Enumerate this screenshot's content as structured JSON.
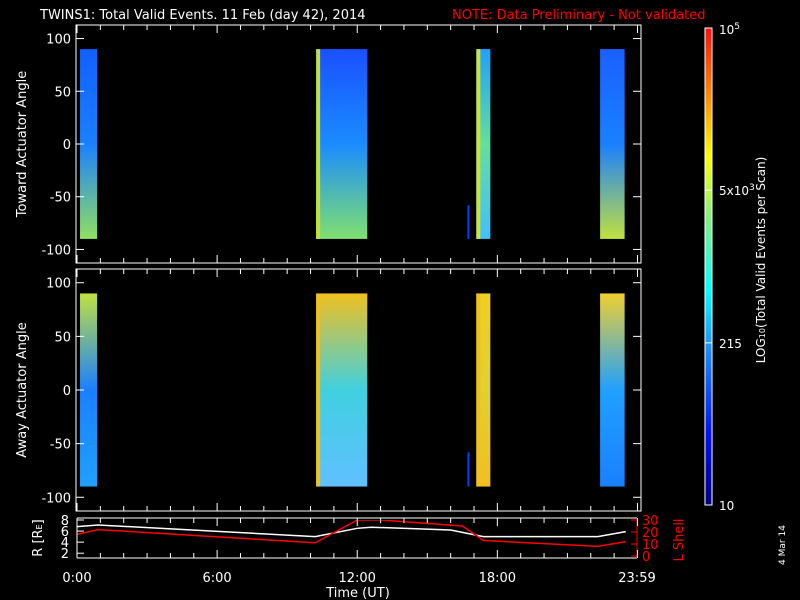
{
  "title": "TWINS1: Total Valid Events. 11 Feb (day  42), 2014",
  "note": "NOTE: Data Preliminary - Not validated",
  "date_stamp": "4 Mar 14",
  "colors": {
    "note": "#ff0000",
    "lshell": "#ff0000",
    "rline": "#ffffff"
  },
  "chart_data": [
    {
      "type": "heatmap",
      "title": "Toward Actuator Angle",
      "ylabel": "Toward Actuator Angle",
      "ylim": [
        -110,
        110
      ],
      "yticks": [
        "100",
        "50",
        "0",
        "-50",
        "-100"
      ],
      "ytick_values": [
        100,
        50,
        0,
        -50,
        -100
      ],
      "xlim": [
        0,
        24
      ],
      "bands": [
        {
          "start": 0.13,
          "end": 0.86,
          "top": "#1060ff",
          "mid": "#1a80ff",
          "bottom": "#90e060"
        },
        {
          "start": 10.24,
          "end": 12.43,
          "top": "#1a50ff",
          "mid": "#1a8cff",
          "bottom": "#80e070",
          "edge": "#c0e040"
        },
        {
          "start": 17.1,
          "end": 17.7,
          "top": "#20a0ff",
          "mid": "#60e0a0",
          "bottom": "#40c0ff",
          "edge": "#d0e040"
        },
        {
          "start": 22.4,
          "end": 23.45,
          "top": "#1a60ff",
          "mid": "#1a80ff",
          "bottom": "#c0e040"
        }
      ],
      "spike": {
        "time": 16.76,
        "from": -90,
        "to": -58,
        "color": "#0040ff"
      }
    },
    {
      "type": "heatmap",
      "title": "Away Actuator Angle",
      "ylabel": "Away Actuator Angle",
      "ylim": [
        -110,
        110
      ],
      "yticks": [
        "100",
        "50",
        "0",
        "-50",
        "-100"
      ],
      "ytick_values": [
        100,
        50,
        0,
        -50,
        -100
      ],
      "xlim": [
        0,
        24
      ],
      "bands": [
        {
          "start": 0.13,
          "end": 0.86,
          "top": "#c0e040",
          "mid": "#1a80ff",
          "bottom": "#20a0ff"
        },
        {
          "start": 10.24,
          "end": 12.43,
          "top": "#f0c020",
          "mid": "#40d0e0",
          "bottom": "#60c0ff",
          "edge": "#f0c020"
        },
        {
          "start": 17.1,
          "end": 17.7,
          "top": "#f0d020",
          "mid": "#e0d030",
          "bottom": "#f0c020",
          "edge": "#f0c020"
        },
        {
          "start": 22.4,
          "end": 23.45,
          "top": "#f0d030",
          "mid": "#20a0ff",
          "bottom": "#1a80ff"
        }
      ],
      "spike": {
        "time": 16.76,
        "from": -90,
        "to": -58,
        "color": "#0040ff"
      }
    },
    {
      "type": "line",
      "ylabel": "R [R",
      "ylabel_sub": "E",
      "ylabel_end": "]",
      "y2label": "L Shell",
      "ylim": [
        1.5,
        8
      ],
      "y2lim": [
        0,
        30
      ],
      "yticks": [
        "8",
        "6",
        "4",
        "2"
      ],
      "ytick_values": [
        8,
        6,
        4,
        2
      ],
      "y2ticks": [
        "30",
        "20",
        "10",
        "0"
      ],
      "y2tick_values": [
        30,
        20,
        10,
        0
      ],
      "xlabel": "Time (UT)",
      "xticks": [
        "0:00",
        "6:00",
        "12:00",
        "18:00",
        "23:59"
      ],
      "xtick_values": [
        0,
        6,
        12,
        18,
        23.98
      ],
      "series": [
        {
          "name": "R",
          "x": [
            0,
            0.9,
            10.2,
            12,
            12.6,
            16,
            17.4,
            22.3,
            23.5
          ],
          "y": [
            6.8,
            7.1,
            5.0,
            6.5,
            6.7,
            6.2,
            5.0,
            5.0,
            5.9
          ]
        },
        {
          "name": "L Shell",
          "x": [
            0,
            0.9,
            10.2,
            12,
            13,
            16.5,
            17.4,
            22.3,
            23.5
          ],
          "y": [
            18,
            22,
            11,
            30,
            30,
            25,
            13,
            8,
            12
          ]
        }
      ]
    }
  ],
  "colorbar": {
    "label": "LOG",
    "label_sub": "10",
    "label_rest": "(Total Valid Events per Scan)",
    "ticks": [
      {
        "base": "10",
        "exp": "5",
        "frac": 1
      },
      {
        "base": "5x10",
        "exp": "3",
        "frac": 0.66
      },
      {
        "base": "215",
        "exp": "",
        "frac": 0.34
      },
      {
        "base": "10",
        "exp": "",
        "frac": 0
      }
    ]
  }
}
